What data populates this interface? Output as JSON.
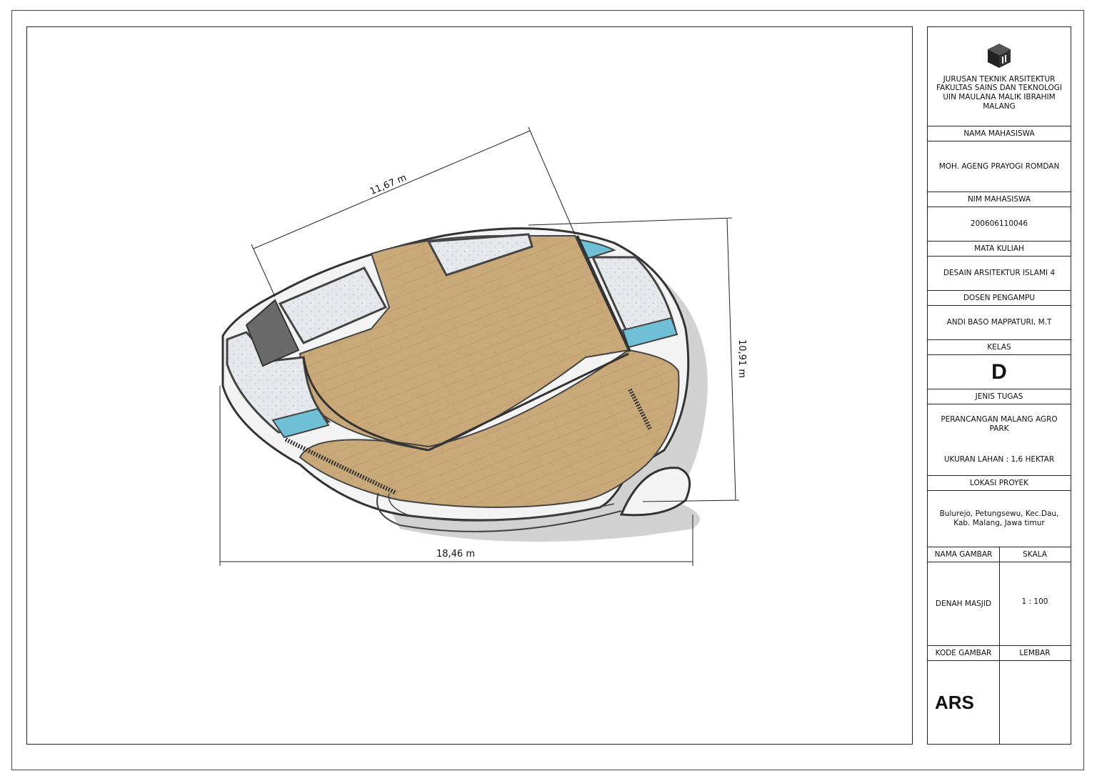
{
  "plan": {
    "dim_top": "11,67 m",
    "dim_right": "10,91 m",
    "dim_bottom": "18,46 m"
  },
  "title_block": {
    "institution": "JURUSAN TEKNIK ARSITEKTUR FAKULTAS SAINS DAN TEKNOLOGI UIN MAULANA MALIK IBRAHIM MALANG",
    "student_label": "NAMA MAHASISWA",
    "student_name": "MOH. AGENG PRAYOGI ROMDAN",
    "nim_label": "NIM MAHASISWA",
    "nim": "200606110046",
    "course_label": "MATA KULIAH",
    "course": "DESAIN ARSITEKTUR ISLAMI 4",
    "lecturer_label": "DOSEN PENGAMPU",
    "lecturer": "ANDI BASO MAPPATURI, M.T",
    "class_label": "KELAS",
    "class": "D",
    "task_label": "JENIS TUGAS",
    "task": "PERANCANGAN MALANG AGRO PARK",
    "site_size": "UKURAN LAHAN : 1,6 HEKTAR",
    "location_label": "LOKASI PROYEK",
    "location": "Bulurejo, Petungsewu, Kec.Dau, Kab. Malang, Jawa timur",
    "drawing_name_label": "NAMA GAMBAR",
    "scale_label": "SKALA",
    "drawing_name": "DENAH MASJID",
    "scale": "1 : 100",
    "drawing_code_label": "KODE GAMBAR",
    "sheet_label": "LEMBAR",
    "drawing_code": "ARS",
    "sheet": ""
  },
  "colors": {
    "wood": "#c9a97a",
    "stone": "#e4e6ea",
    "water": "#6fc0d6",
    "wall": "#6a6a6a",
    "shadow": "#d2d2d2"
  }
}
